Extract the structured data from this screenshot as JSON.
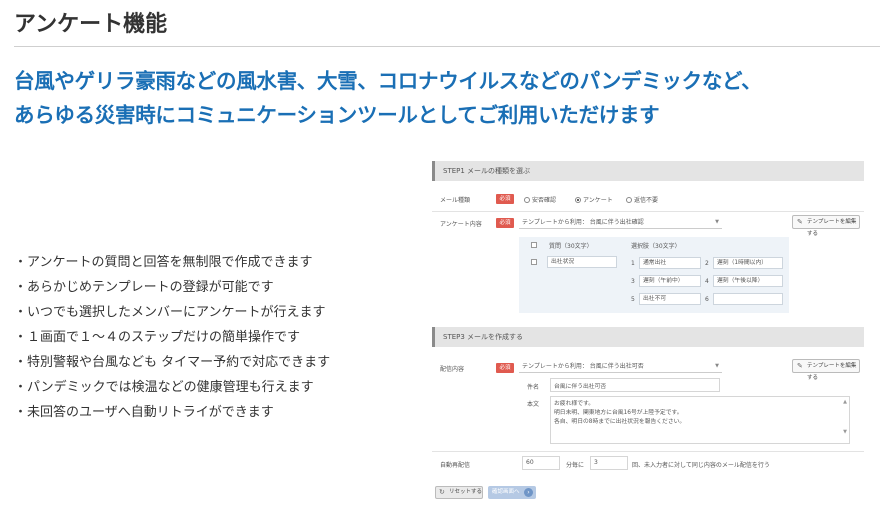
{
  "page": {
    "title": "アンケート機能",
    "headline_line1": "台風やゲリラ豪雨などの風水害、大雪、コロナウイルスなどのパンデミックなど、",
    "headline_line2": "あらゆる災害時にコミュニケーションツールとしてご利用いただけます"
  },
  "features": [
    "・アンケートの質問と回答を無制限で作成できます",
    "・あらかじめテンプレートの登録が可能です",
    "・いつでも選択したメンバーにアンケートが行えます",
    "・１画面で１～４のステップだけの簡単操作です",
    "・特別警報や台風なども タイマー予約で対応できます",
    "・パンデミックでは検温などの健康管理も行えます",
    "・未回答のユーザへ自動リトライができます"
  ],
  "mock": {
    "step1": {
      "header": "STEP1 メールの種類を選ぶ",
      "mail_type_label": "メール種類",
      "required": "必須",
      "options": [
        "安否確認",
        "アンケート",
        "返信不要"
      ],
      "selected_option": "アンケート",
      "survey_label": "アンケート内容",
      "template_select": "テンプレートから利用： 台風に伴う出社確認",
      "edit_template_button": "テンプレートを編集する",
      "question_header": "質問（30文字）",
      "choices_header": "選択肢（30文字）",
      "question_value": "出社状況",
      "choices": [
        {
          "num": "1",
          "text": "通常出社"
        },
        {
          "num": "2",
          "text": "遅刻（1時間以内）"
        },
        {
          "num": "3",
          "text": "遅刻（午前中）"
        },
        {
          "num": "4",
          "text": "遅刻（午後以降）"
        },
        {
          "num": "5",
          "text": "出社不可"
        },
        {
          "num": "6",
          "text": ""
        }
      ]
    },
    "step3": {
      "header": "STEP3 メールを作成する",
      "delivery_label": "配信内容",
      "required": "必須",
      "template_select": "テンプレートから利用： 台風に伴う出社可否",
      "edit_template_button": "テンプレートを編集する",
      "subject_label": "件名",
      "subject_value": "台風に伴う出社可否",
      "body_label": "本文",
      "body_lines": [
        "お疲れ様です。",
        "明日未明、関東地方に台風16号が上陸予定です。",
        "各自、明日の8時までに出社状況を報告ください。"
      ],
      "resend_label": "自動再配信",
      "resend_interval": "60",
      "resend_unit": "分毎に",
      "resend_count": "3",
      "resend_suffix": "回、未入力者に対して同じ内容のメール配信を行う"
    },
    "reset_button": "リセットする",
    "confirm_button": "確認画面へ"
  }
}
